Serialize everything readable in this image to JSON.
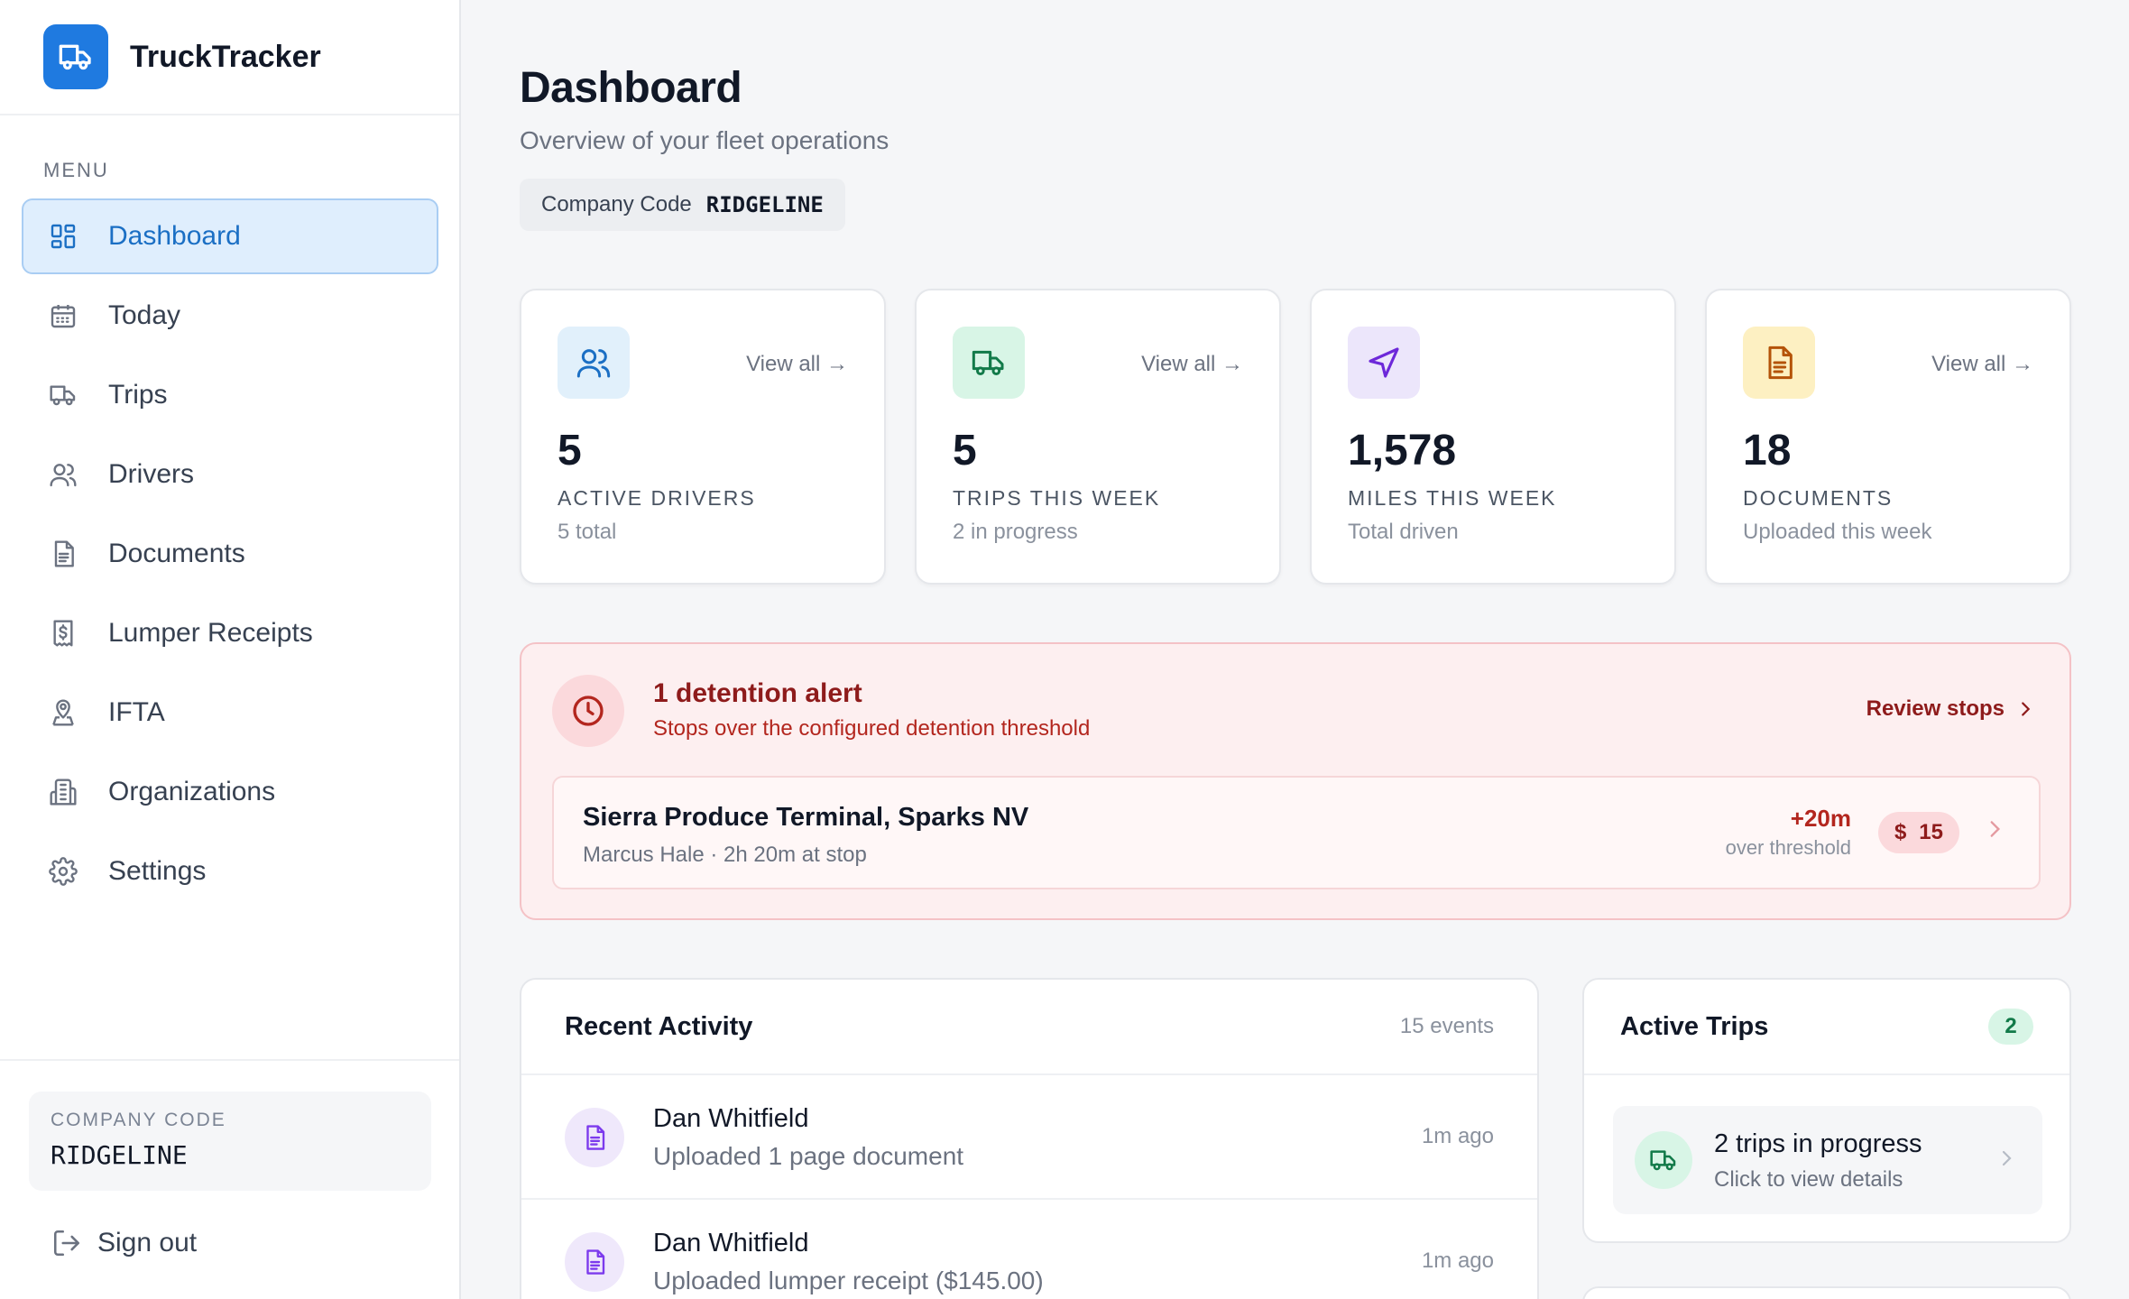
{
  "app": {
    "name": "TruckTracker",
    "logo_icon": "truck-icon",
    "accent_color": "#1f7ae0"
  },
  "sidebar": {
    "menu_label": "MENU",
    "items": [
      {
        "label": "Dashboard",
        "icon": "dashboard-grid-icon",
        "active": true
      },
      {
        "label": "Today",
        "icon": "calendar-icon"
      },
      {
        "label": "Trips",
        "icon": "truck-icon"
      },
      {
        "label": "Drivers",
        "icon": "users-icon"
      },
      {
        "label": "Documents",
        "icon": "document-icon"
      },
      {
        "label": "Lumper Receipts",
        "icon": "receipt-dollar-icon"
      },
      {
        "label": "IFTA",
        "icon": "map-pin-icon"
      },
      {
        "label": "Organizations",
        "icon": "building-icon"
      },
      {
        "label": "Settings",
        "icon": "gear-icon"
      }
    ],
    "footer": {
      "company_code_label": "COMPANY CODE",
      "company_code": "RIDGELINE",
      "sign_out_label": "Sign out"
    }
  },
  "header": {
    "title": "Dashboard",
    "subtitle": "Overview of your fleet operations",
    "company_code_label": "Company Code",
    "company_code": "RIDGELINE"
  },
  "stats": [
    {
      "icon": "users-icon",
      "icon_bg": "#e1f0fb",
      "icon_color": "#1b6fc4",
      "link": "View all →",
      "value": "5",
      "label": "ACTIVE DRIVERS",
      "sub": "5 total"
    },
    {
      "icon": "truck-icon",
      "icon_bg": "#d8f5e6",
      "icon_color": "#127a49",
      "link": "View all →",
      "value": "5",
      "label": "TRIPS THIS WEEK",
      "sub": "2 in progress"
    },
    {
      "icon": "navigation-arrow-icon",
      "icon_bg": "#ece6fb",
      "icon_color": "#6d28d9",
      "link": "",
      "value": "1,578",
      "label": "MILES THIS WEEK",
      "sub": "Total driven"
    },
    {
      "icon": "document-icon",
      "icon_bg": "#fdf0c2",
      "icon_color": "#b45309",
      "link": "View all →",
      "value": "18",
      "label": "DOCUMENTS",
      "sub": "Uploaded this week"
    }
  ],
  "alert": {
    "title": "1 detention alert",
    "subtitle": "Stops over the configured detention threshold",
    "action": "Review stops",
    "stop": {
      "name": "Sierra Produce Terminal, Sparks NV",
      "meta": "Marcus Hale · 2h 20m at stop",
      "over_value": "+20m",
      "over_label": "over threshold",
      "fee_symbol": "$",
      "fee_amount": "15"
    }
  },
  "activity": {
    "title": "Recent Activity",
    "count": "15 events",
    "items": [
      {
        "name": "Dan Whitfield",
        "desc": "Uploaded 1 page document",
        "time": "1m ago"
      },
      {
        "name": "Dan Whitfield",
        "desc": "Uploaded lumper receipt ($145.00)",
        "time": "1m ago"
      }
    ]
  },
  "active_trips": {
    "title": "Active Trips",
    "badge": "2",
    "row_title": "2 trips in progress",
    "row_sub": "Click to view details"
  }
}
